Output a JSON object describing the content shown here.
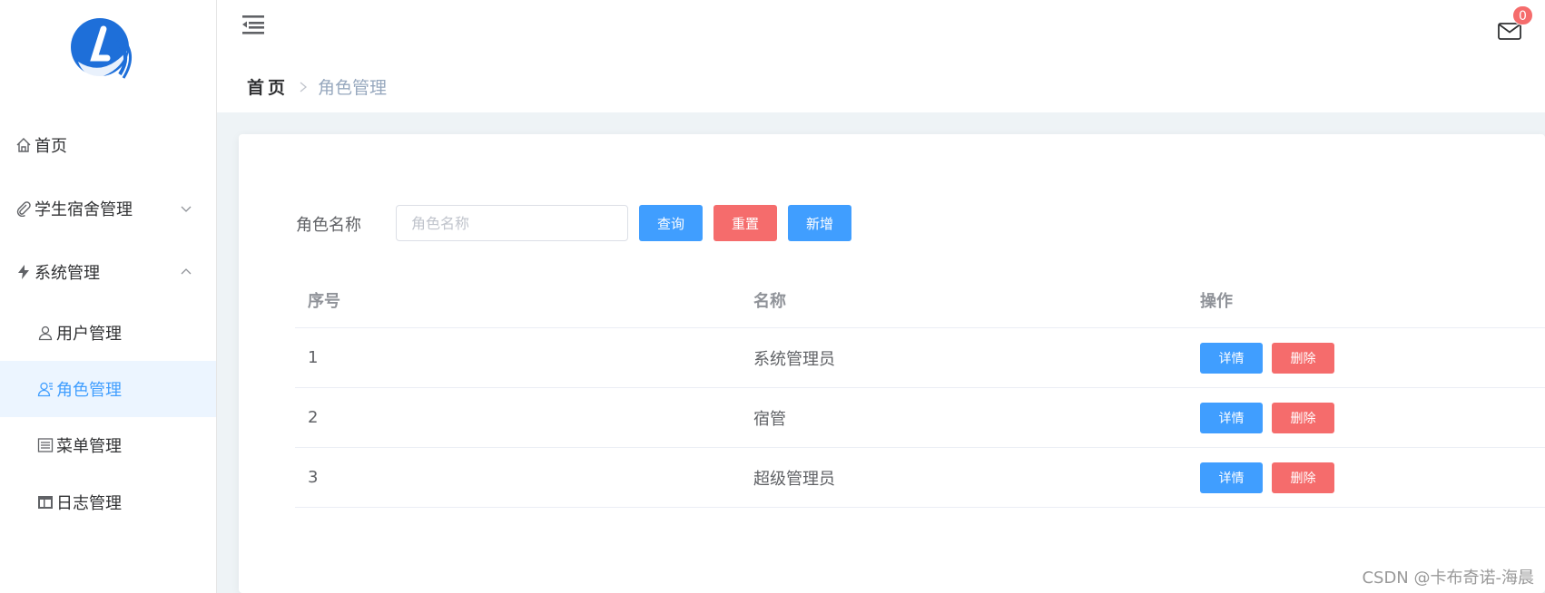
{
  "sidebar": {
    "items": [
      {
        "label": "首页",
        "icon": "home-icon"
      },
      {
        "label": "学生宿舍管理",
        "icon": "paperclip-icon",
        "chevron": "down"
      },
      {
        "label": "系统管理",
        "icon": "lightning-icon",
        "chevron": "up"
      },
      {
        "label": "用户管理",
        "icon": "user-icon"
      },
      {
        "label": "角色管理",
        "icon": "user-role-icon",
        "active": true
      },
      {
        "label": "菜单管理",
        "icon": "list-icon"
      },
      {
        "label": "日志管理",
        "icon": "table-icon"
      }
    ]
  },
  "header": {
    "breadcrumb": {
      "home": "首页",
      "current": "角色管理"
    },
    "badge_count": "0"
  },
  "filter": {
    "label": "角色名称",
    "placeholder": "角色名称",
    "query_label": "查询",
    "reset_label": "重置",
    "add_label": "新增"
  },
  "table": {
    "columns": [
      "序号",
      "名称",
      "操作"
    ],
    "rows": [
      {
        "index": "1",
        "name": "系统管理员"
      },
      {
        "index": "2",
        "name": "宿管"
      },
      {
        "index": "3",
        "name": "超级管理员"
      }
    ],
    "detail_label": "详情",
    "delete_label": "删除"
  },
  "watermark": "CSDN @卡布奇诺-海晨",
  "colors": {
    "primary": "#409eff",
    "danger": "#f56c6c",
    "active_bg": "#ecf5ff"
  }
}
